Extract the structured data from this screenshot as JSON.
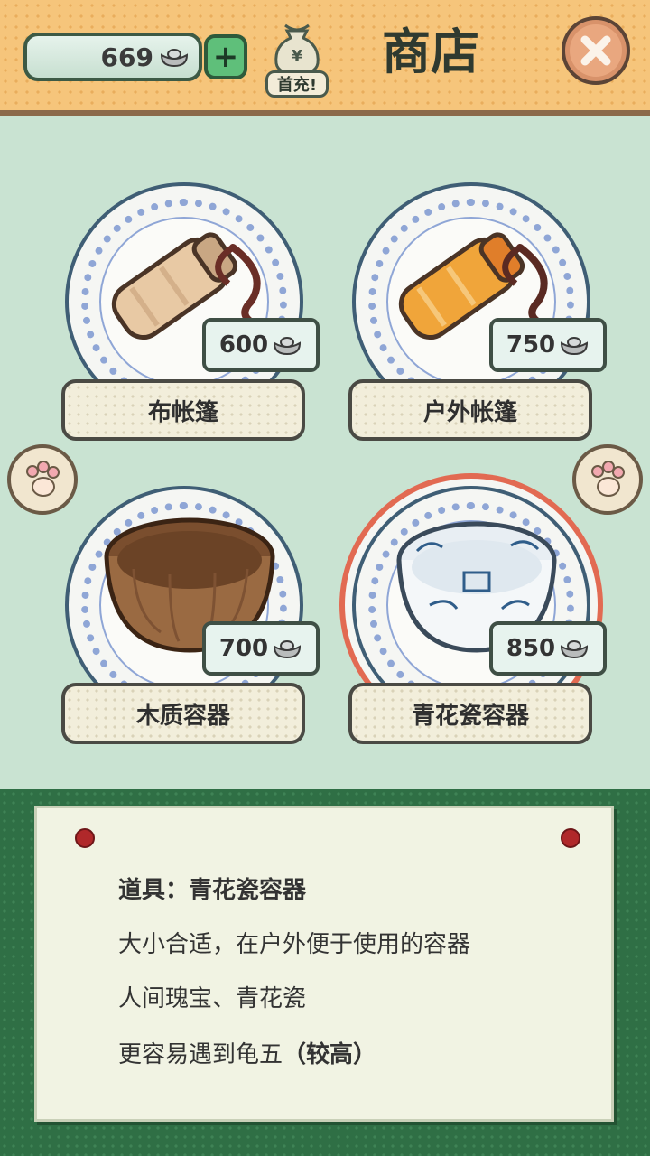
{
  "header": {
    "currency_value": "669",
    "currency_icon": "silver-ingot-icon",
    "plus_label": "+",
    "first_charge_label": "首充!",
    "title": "商店",
    "close_icon": "close-icon"
  },
  "items": [
    {
      "name": "布帐篷",
      "price": "600",
      "icon": "cloth-tent-bag-icon",
      "selected": false
    },
    {
      "name": "户外帐篷",
      "price": "750",
      "icon": "outdoor-tent-bag-icon",
      "selected": false
    },
    {
      "name": "木质容器",
      "price": "700",
      "icon": "wooden-bowl-icon",
      "selected": false
    },
    {
      "name": "青花瓷容器",
      "price": "850",
      "icon": "porcelain-bowl-icon",
      "selected": true
    }
  ],
  "nav": {
    "prev_icon": "paw-icon",
    "next_icon": "paw-icon"
  },
  "info": {
    "title": "道具：青花瓷容器",
    "line1": "大小合适，在户外便于使用的容器",
    "line2": "人间瑰宝、青花瓷",
    "line3_prefix": "更容易遇到龟五",
    "line3_emph": "（较高）"
  },
  "colors": {
    "header_bg": "#f6c57b",
    "shop_bg": "#c9e3d2",
    "info_bg": "#2f6f45",
    "selected_ring": "#e26a52"
  }
}
